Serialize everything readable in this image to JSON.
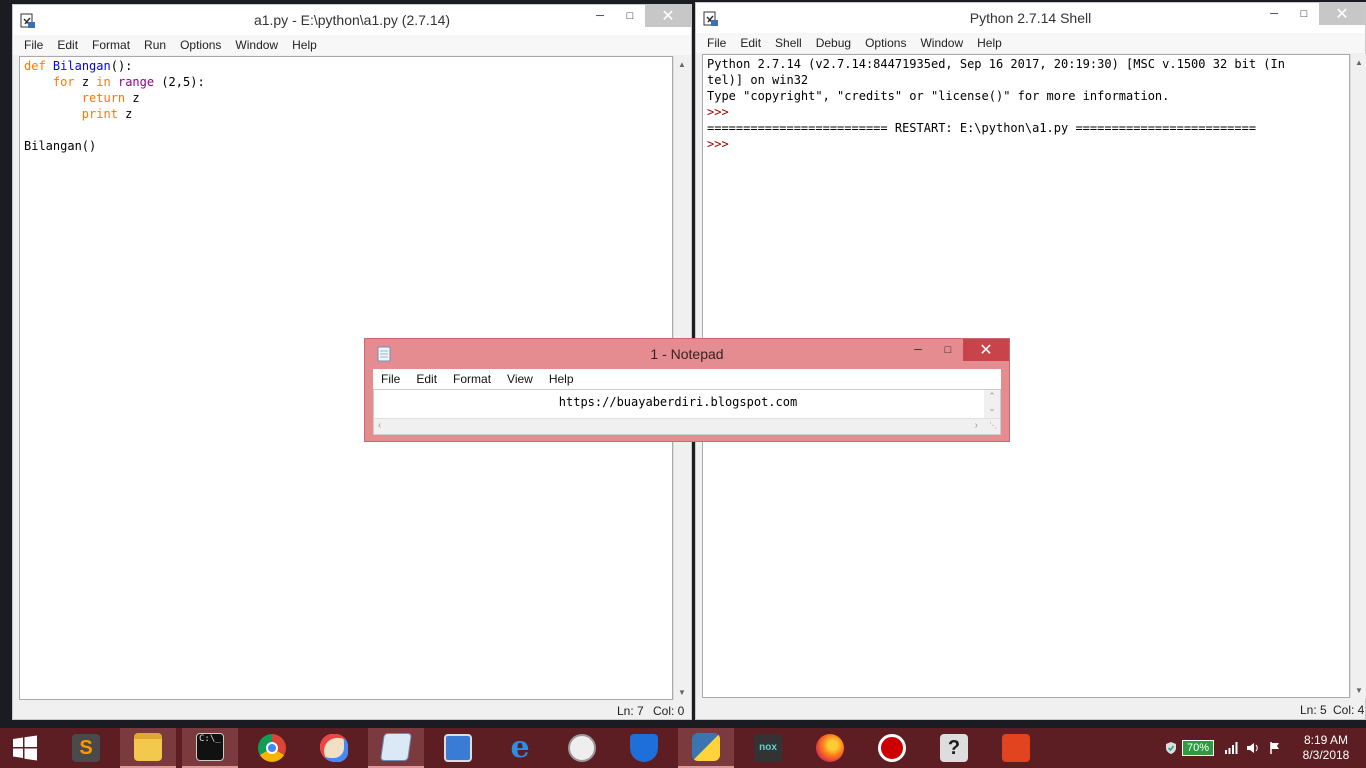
{
  "idle_editor": {
    "title": "a1.py - E:\\python\\a1.py (2.7.14)",
    "menu": [
      "File",
      "Edit",
      "Format",
      "Run",
      "Options",
      "Window",
      "Help"
    ],
    "code": {
      "l1_kw": "def",
      "l1_fn": "Bilangan",
      "l1_rest": "():",
      "l2_kw1": "for",
      "l2_mid1": " z ",
      "l2_kw2": "in",
      "l2_sp": " ",
      "l2_bi": "range",
      "l2_rest": " (2,5):",
      "l3_kw": "return",
      "l3_rest": " z",
      "l4_kw": "print",
      "l4_rest": " z",
      "l6": "Bilangan()"
    },
    "status": {
      "ln": "Ln: 7",
      "col": "Col: 0"
    }
  },
  "shell": {
    "title": "Python 2.7.14 Shell",
    "menu": [
      "File",
      "Edit",
      "Shell",
      "Debug",
      "Options",
      "Window",
      "Help"
    ],
    "lines": [
      "Python 2.7.14 (v2.7.14:84471935ed, Sep 16 2017, 20:19:30) [MSC v.1500 32 bit (In",
      "tel)] on win32",
      "Type \"copyright\", \"credits\" or \"license()\" for more information."
    ],
    "prompt": ">>>",
    "restart": "========================= RESTART: E:\\python\\a1.py =========================",
    "status": {
      "ln": "Ln: 5",
      "col": "Col: 4"
    }
  },
  "notepad": {
    "title": "1 - Notepad",
    "menu": [
      "File",
      "Edit",
      "Format",
      "View",
      "Help"
    ],
    "text": "https://buayaberdiri.blogspot.com"
  },
  "taskbar": {
    "battery": "70%",
    "time": "8:19 AM",
    "date": "8/3/2018",
    "icons": [
      "windows-start-icon",
      "sublime-text-icon",
      "file-explorer-icon",
      "command-prompt-icon",
      "chrome-icon",
      "paint-icon",
      "notepad-icon",
      "on-screen-keyboard-icon",
      "internet-explorer-icon",
      "compass-icon",
      "windows-defender-icon",
      "python-icon",
      "nox-icon",
      "firefox-icon",
      "garena-icon",
      "help-icon",
      "office-icon"
    ]
  },
  "colors": {
    "notepad_title": "#e58c90",
    "taskbar": "#5c1e22",
    "keyword": "#ff7700",
    "function": "#0000ff",
    "builtin": "#900090",
    "prompt": "#a00000"
  }
}
